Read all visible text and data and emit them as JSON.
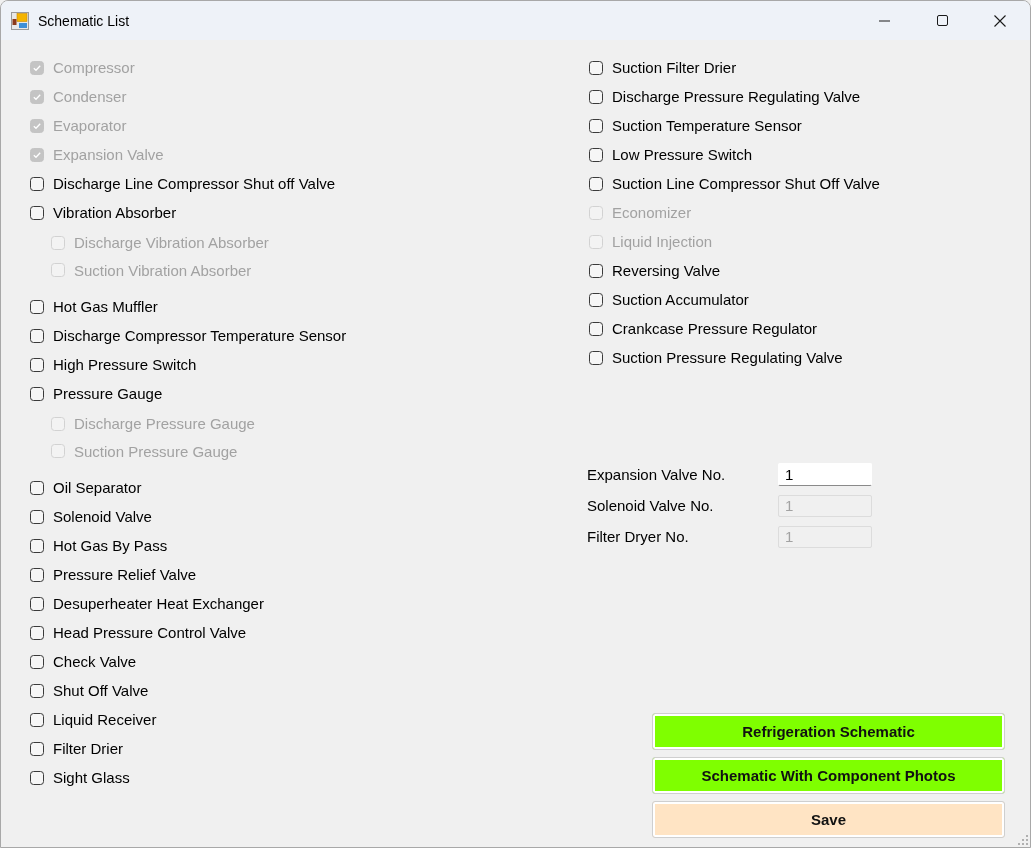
{
  "window": {
    "title": "Schematic List"
  },
  "left_items": [
    {
      "label": "Compressor",
      "checked": true,
      "disabled": true
    },
    {
      "label": "Condenser",
      "checked": true,
      "disabled": true
    },
    {
      "label": "Evaporator",
      "checked": true,
      "disabled": true
    },
    {
      "label": "Expansion Valve",
      "checked": true,
      "disabled": true
    },
    {
      "label": "Discharge Line Compressor Shut off Valve",
      "checked": false,
      "disabled": false
    },
    {
      "label": "Vibration Absorber",
      "checked": false,
      "disabled": false,
      "children": [
        {
          "label": "Discharge Vibration Absorber",
          "checked": false,
          "disabled": true
        },
        {
          "label": "Suction Vibration Absorber",
          "checked": false,
          "disabled": true
        }
      ]
    },
    {
      "label": "Hot Gas Muffler",
      "checked": false,
      "disabled": false
    },
    {
      "label": "Discharge Compressor Temperature Sensor",
      "checked": false,
      "disabled": false
    },
    {
      "label": "High Pressure Switch",
      "checked": false,
      "disabled": false
    },
    {
      "label": "Pressure Gauge",
      "checked": false,
      "disabled": false,
      "children": [
        {
          "label": "Discharge Pressure Gauge",
          "checked": false,
          "disabled": true
        },
        {
          "label": "Suction Pressure Gauge",
          "checked": false,
          "disabled": true
        }
      ]
    },
    {
      "label": "Oil Separator",
      "checked": false,
      "disabled": false
    },
    {
      "label": "Solenoid Valve",
      "checked": false,
      "disabled": false
    },
    {
      "label": "Hot Gas By Pass",
      "checked": false,
      "disabled": false
    },
    {
      "label": "Pressure Relief Valve",
      "checked": false,
      "disabled": false
    },
    {
      "label": "Desuperheater Heat Exchanger",
      "checked": false,
      "disabled": false
    },
    {
      "label": "Head Pressure Control Valve",
      "checked": false,
      "disabled": false
    },
    {
      "label": "Check Valve",
      "checked": false,
      "disabled": false
    },
    {
      "label": "Shut Off Valve",
      "checked": false,
      "disabled": false
    },
    {
      "label": "Liquid Receiver",
      "checked": false,
      "disabled": false
    },
    {
      "label": "Filter Drier",
      "checked": false,
      "disabled": false
    },
    {
      "label": "Sight Glass",
      "checked": false,
      "disabled": false
    }
  ],
  "right_items": [
    {
      "label": "Suction Filter Drier",
      "checked": false,
      "disabled": false
    },
    {
      "label": "Discharge Pressure Regulating Valve",
      "checked": false,
      "disabled": false
    },
    {
      "label": "Suction Temperature Sensor",
      "checked": false,
      "disabled": false
    },
    {
      "label": "Low Pressure Switch",
      "checked": false,
      "disabled": false
    },
    {
      "label": "Suction Line Compressor Shut Off Valve",
      "checked": false,
      "disabled": false
    },
    {
      "label": "Economizer",
      "checked": false,
      "disabled": true
    },
    {
      "label": "Liquid Injection",
      "checked": false,
      "disabled": true
    },
    {
      "label": "Reversing Valve",
      "checked": false,
      "disabled": false
    },
    {
      "label": "Suction Accumulator",
      "checked": false,
      "disabled": false
    },
    {
      "label": "Crankcase Pressure Regulator",
      "checked": false,
      "disabled": false
    },
    {
      "label": "Suction Pressure Regulating Valve",
      "checked": false,
      "disabled": false
    }
  ],
  "count_fields": [
    {
      "label": "Expansion Valve No.",
      "value": "1",
      "disabled": false
    },
    {
      "label": "Solenoid Valve No.",
      "value": "1",
      "disabled": true
    },
    {
      "label": "Filter Dryer No.",
      "value": "1",
      "disabled": true
    }
  ],
  "buttons": [
    {
      "label": "Refrigeration Schematic",
      "color": "#7fff00"
    },
    {
      "label": "Schematic With Component Photos",
      "color": "#7fff00"
    },
    {
      "label": "Save",
      "color": "#ffe4c4"
    }
  ]
}
